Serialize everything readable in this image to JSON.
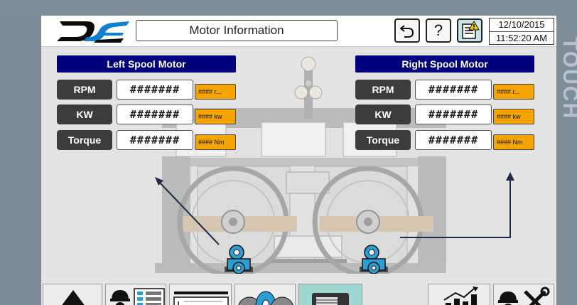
{
  "header": {
    "title": "Motor Information",
    "date": "12/10/2015",
    "time": "11:52:20 AM"
  },
  "bezel_text": "TOUCH",
  "toolbar": {
    "back_icon": "undo-arrow-icon",
    "help_label": "?",
    "alarm_icon": "alarm-notes-icon"
  },
  "left_motor": {
    "title": "Left Spool Motor",
    "rows": [
      {
        "label": "RPM",
        "value": "#######",
        "unit": "#### r..."
      },
      {
        "label": "KW",
        "value": "#######",
        "unit": "#### kw"
      },
      {
        "label": "Torque",
        "value": "#######",
        "unit": "#### Nm"
      }
    ]
  },
  "right_motor": {
    "title": "Right Spool Motor",
    "rows": [
      {
        "label": "RPM",
        "value": "#######",
        "unit": "#### r..."
      },
      {
        "label": "KW",
        "value": "#######",
        "unit": "#### kw"
      },
      {
        "label": "Torque",
        "value": "#######",
        "unit": "#### Nm"
      }
    ]
  },
  "nav": {
    "icons": [
      "home-icon",
      "operator-settings-icon",
      "drawing-icon",
      "spools-icon",
      "motor-icon",
      "trend-chart-icon",
      "maintenance-icon"
    ]
  },
  "colors": {
    "panel_header": "#00007f",
    "unit_badge": "#f5a400",
    "motor_blue": "#2a9fd6",
    "active_nav": "#9fd8d0"
  }
}
